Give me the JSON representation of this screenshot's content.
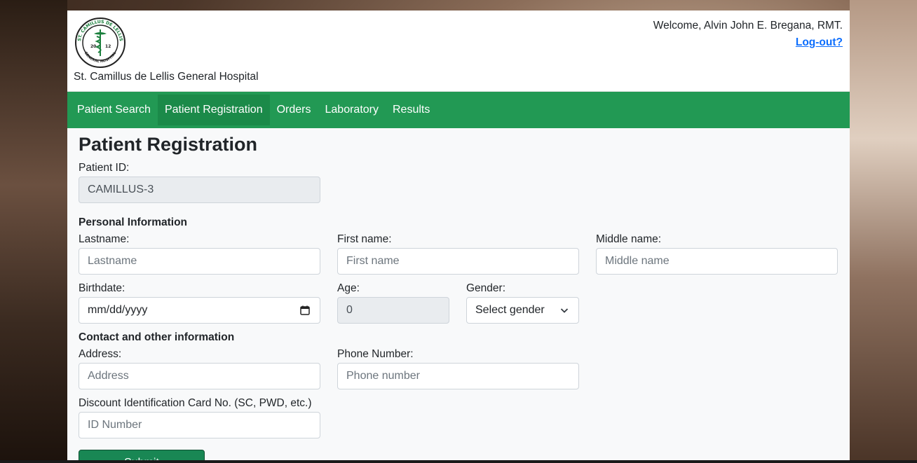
{
  "header": {
    "hospital_name": "St. Camillus de Lellis General Hospital",
    "logo_text_top": "ST. CAMILLUS DE LELLIS",
    "logo_text_bottom": "GENERAL HOSPITAL",
    "logo_year_left": "20",
    "logo_year_right": "12",
    "welcome": "Welcome, Alvin John E. Bregana, RMT.",
    "logout": "Log-out?"
  },
  "nav": {
    "items": [
      {
        "label": "Patient Search"
      },
      {
        "label": "Patient Registration",
        "active": true
      },
      {
        "label": "Orders"
      },
      {
        "label": "Laboratory"
      },
      {
        "label": "Results"
      }
    ]
  },
  "form": {
    "title": "Patient Registration",
    "patient_id_label": "Patient ID:",
    "patient_id_value": "CAMILLUS-3",
    "personal_section": "Personal Information",
    "lastname_label": "Lastname:",
    "lastname_placeholder": "Lastname",
    "firstname_label": "First name:",
    "firstname_placeholder": "First name",
    "middlename_label": "Middle name:",
    "middlename_placeholder": "Middle name",
    "birthdate_label": "Birthdate:",
    "birthdate_placeholder": "mm/dd/yyyy",
    "age_label": "Age:",
    "age_value": "0",
    "gender_label": "Gender:",
    "gender_selected": "Select gender",
    "contact_section": "Contact and other information",
    "address_label": "Address:",
    "address_placeholder": "Address",
    "phone_label": "Phone Number:",
    "phone_placeholder": "Phone number",
    "discount_label": "Discount Identification Card No. (SC, PWD, etc.)",
    "discount_placeholder": "ID Number",
    "submit_label": "Submit"
  },
  "colors": {
    "nav_bg": "#229954",
    "nav_active_bg": "#1b8a49",
    "link": "#0d6efd",
    "submit_bg": "#198754"
  }
}
